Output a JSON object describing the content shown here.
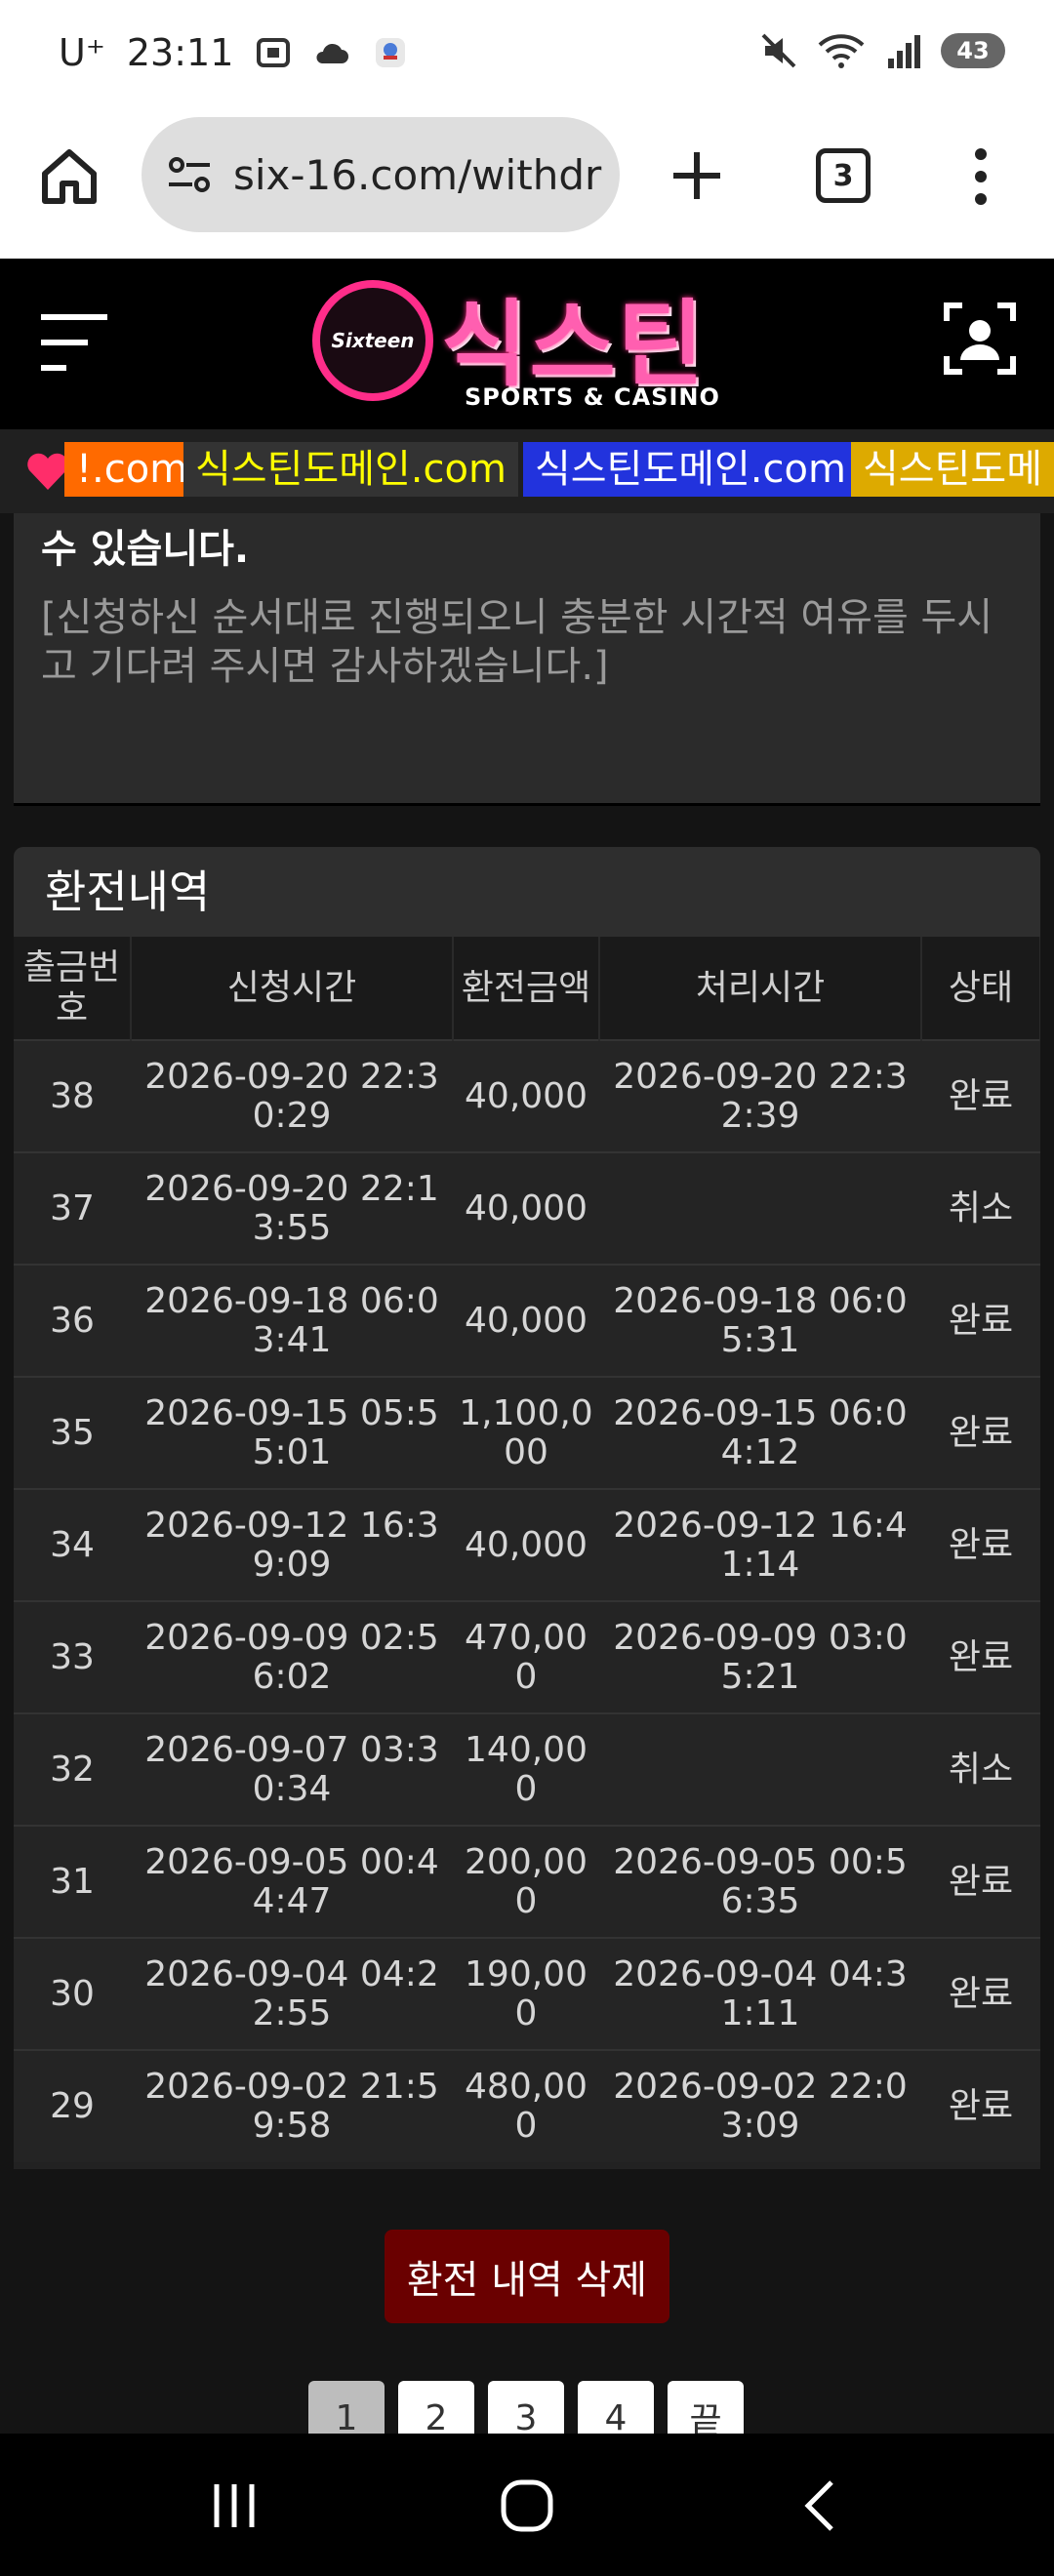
{
  "status_bar": {
    "carrier": "U⁺",
    "time": "23:11",
    "battery": "43"
  },
  "browser": {
    "url": "six-16.com/withdr",
    "tab_count": "3"
  },
  "site": {
    "logo_badge": "Sixteen",
    "logo_title": "식스틴",
    "logo_subtitle": "SPORTS & CASINO"
  },
  "ticker": [
    {
      "text": "!.com",
      "bg": "#ff6a00",
      "color": "#ffffff"
    },
    {
      "text": "식스틴도메인.com",
      "bg": "#333333",
      "color": "#ffff00"
    },
    {
      "text": "식스틴도메인.com",
      "bg": "#2233dd",
      "color": "#ffffff"
    },
    {
      "text": "식스틴도메",
      "bg": "#ddaa00",
      "color": "#ffffff"
    }
  ],
  "notice": {
    "strong_line": "수 있습니다.",
    "body": "[신청하신 순서대로 진행되오니 충분한 시간적 여유를 두시고 기다려 주시면 감사하겠습니다.]"
  },
  "history": {
    "title": "환전내역",
    "columns": [
      "출금번호",
      "신청시간",
      "환전금액",
      "처리시간",
      "상태"
    ],
    "rows": [
      {
        "no": "38",
        "requested": "2026-09-20 22:30:29",
        "amount": "40,000",
        "processed": "2026-09-20 22:32:39",
        "status": "완료"
      },
      {
        "no": "37",
        "requested": "2026-09-20 22:13:55",
        "amount": "40,000",
        "processed": "",
        "status": "취소"
      },
      {
        "no": "36",
        "requested": "2026-09-18 06:03:41",
        "amount": "40,000",
        "processed": "2026-09-18 06:05:31",
        "status": "완료"
      },
      {
        "no": "35",
        "requested": "2026-09-15 05:55:01",
        "amount": "1,100,000",
        "processed": "2026-09-15 06:04:12",
        "status": "완료"
      },
      {
        "no": "34",
        "requested": "2026-09-12 16:39:09",
        "amount": "40,000",
        "processed": "2026-09-12 16:41:14",
        "status": "완료"
      },
      {
        "no": "33",
        "requested": "2026-09-09 02:56:02",
        "amount": "470,000",
        "processed": "2026-09-09 03:05:21",
        "status": "완료"
      },
      {
        "no": "32",
        "requested": "2026-09-07 03:30:34",
        "amount": "140,000",
        "processed": "",
        "status": "취소"
      },
      {
        "no": "31",
        "requested": "2026-09-05 00:44:47",
        "amount": "200,000",
        "processed": "2026-09-05 00:56:35",
        "status": "완료"
      },
      {
        "no": "30",
        "requested": "2026-09-04 04:22:55",
        "amount": "190,000",
        "processed": "2026-09-04 04:31:11",
        "status": "완료"
      },
      {
        "no": "29",
        "requested": "2026-09-02 21:59:58",
        "amount": "480,000",
        "processed": "2026-09-02 22:03:09",
        "status": "완료"
      }
    ],
    "delete_label": "환전 내역 삭제"
  },
  "pagination": {
    "pages": [
      "1",
      "2",
      "3",
      "4",
      "끝"
    ],
    "active": "1"
  },
  "colors": {
    "accent": "#ff2d8a",
    "delete_button": "#6a0000"
  }
}
